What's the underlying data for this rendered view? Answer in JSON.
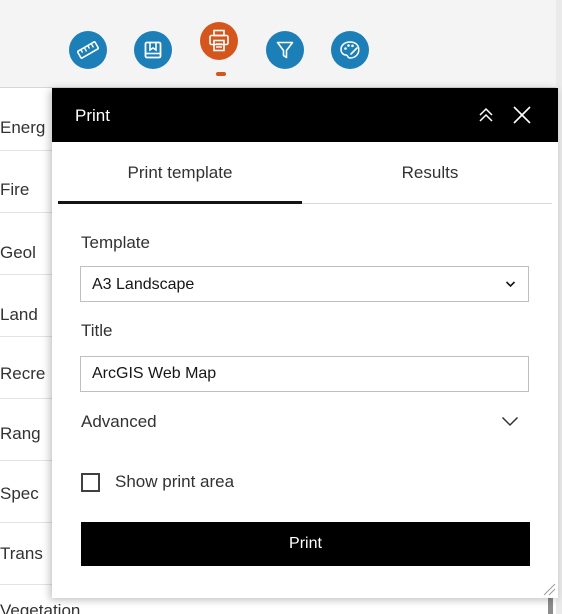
{
  "colors": {
    "accent_blue": "#1d7fb8",
    "active_orange": "#d4561d",
    "header_black": "#000000",
    "print_button": "#000000"
  },
  "toolbar": {
    "tools": [
      {
        "name": "measure",
        "icon": "ruler-icon",
        "active": false
      },
      {
        "name": "bookmarks",
        "icon": "bookmark-icon",
        "active": false
      },
      {
        "name": "print",
        "icon": "printer-icon",
        "active": true
      },
      {
        "name": "filter",
        "icon": "filter-icon",
        "active": false
      },
      {
        "name": "basemap",
        "icon": "palette-icon",
        "active": false
      }
    ]
  },
  "layers": {
    "items": [
      "Energ",
      "Fire",
      "Geol",
      "Land",
      "Recre",
      "Rang",
      "Spec",
      "Trans"
    ],
    "last_item": "Vegetation",
    "more_label": "..."
  },
  "panel": {
    "title": "Print",
    "collapse_icon": "double-chevron-up-icon",
    "close_icon": "close-icon",
    "tabs": [
      {
        "label": "Print template",
        "active": true
      },
      {
        "label": "Results",
        "active": false
      }
    ],
    "template": {
      "label": "Template",
      "selected": "A3 Landscape"
    },
    "title_field": {
      "label": "Title",
      "value": "ArcGIS Web Map"
    },
    "advanced": {
      "label": "Advanced"
    },
    "show_print_area": {
      "label": "Show print area",
      "checked": false
    },
    "print_button": {
      "label": "Print"
    }
  }
}
